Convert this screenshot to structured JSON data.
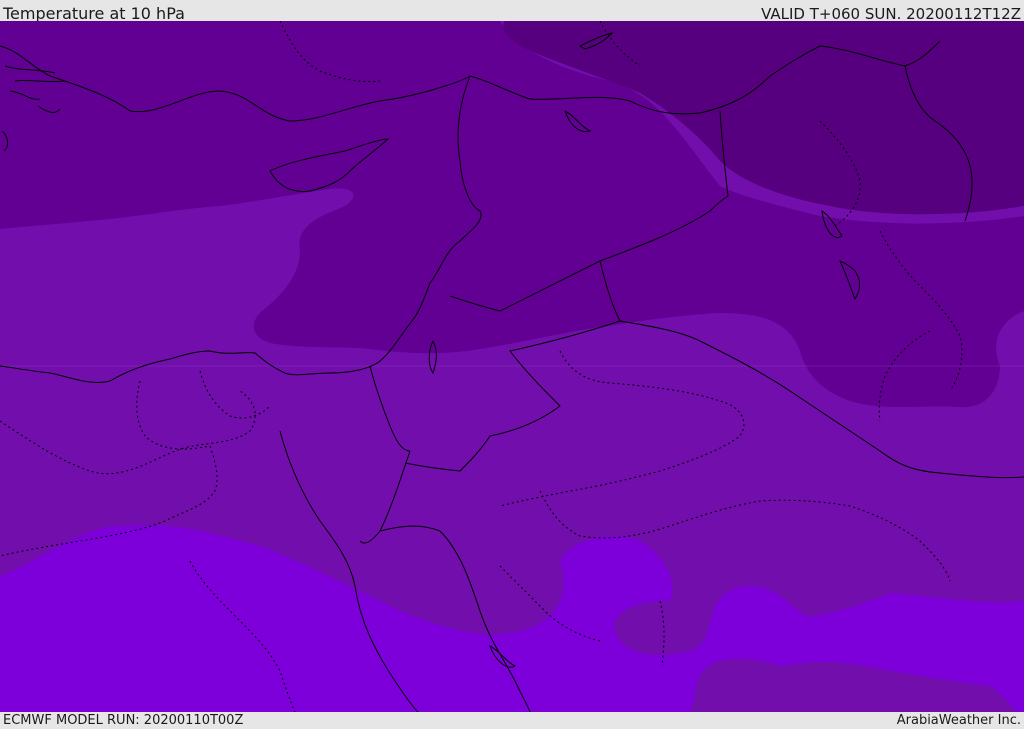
{
  "header": {
    "title": "Temperature at 10 hPa",
    "valid": "VALID T+060 SUN. 20200112T12Z"
  },
  "footer": {
    "model_run": "ECMWF MODEL RUN: 20200110T00Z",
    "credit": "ArabiaWeather Inc."
  },
  "colors": {
    "band_darkest": "#57007f",
    "band_dark": "#620094",
    "band_mid": "#720fac",
    "band_light": "#7d00da",
    "coastline": "#000000",
    "border": "#000000",
    "bar_background": "#e6e6e6"
  },
  "map": {
    "field": "temperature",
    "level_hpa": 10,
    "region": "Eastern Mediterranean / Middle East"
  }
}
